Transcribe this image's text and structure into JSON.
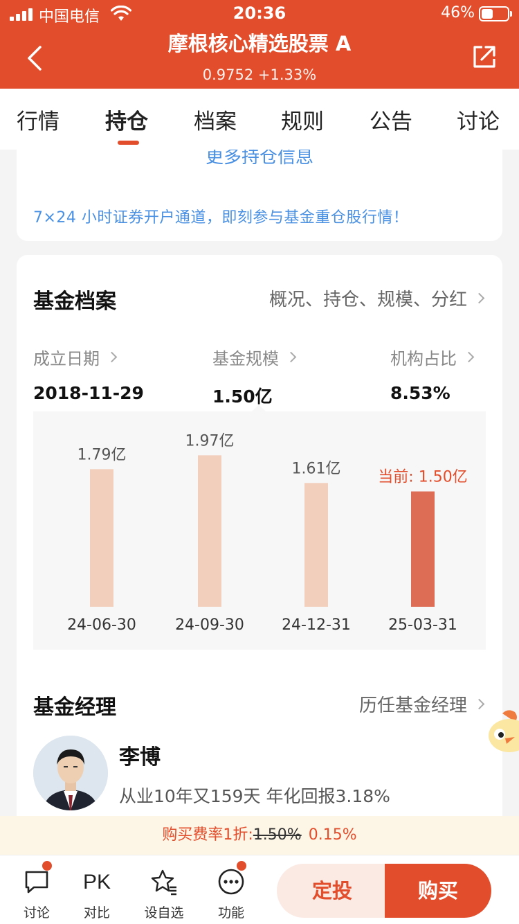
{
  "status_bar": {
    "carrier": "中国电信",
    "time": "20:36",
    "battery": "46%"
  },
  "header": {
    "title": "摩根核心精选股票 A",
    "subtitle": "0.9752 +1.33%"
  },
  "tabs": [
    {
      "label": "行情"
    },
    {
      "label": "持仓"
    },
    {
      "label": "档案"
    },
    {
      "label": "规则"
    },
    {
      "label": "公告"
    },
    {
      "label": "讨论"
    }
  ],
  "active_tab": "持仓",
  "holdings_card": {
    "more_link": "更多持仓信息",
    "promo": "7×24 小时证券开户通道，即刻参与基金重仓股行情！"
  },
  "fund_profile": {
    "title": "基金档案",
    "link": "概况、持仓、规模、分红",
    "stats": [
      {
        "label": "成立日期",
        "value": "2018-11-29"
      },
      {
        "label": "基金规模",
        "value": "1.50亿"
      },
      {
        "label": "机构占比",
        "value": "8.53%"
      }
    ]
  },
  "chart_data": {
    "type": "bar",
    "categories": [
      "24-06-30",
      "24-09-30",
      "24-12-31",
      "25-03-31"
    ],
    "values": [
      1.79,
      1.97,
      1.61,
      1.5
    ],
    "data_labels": [
      "1.79亿",
      "1.97亿",
      "1.61亿",
      "当前: 1.50亿"
    ],
    "unit": "亿",
    "highlight_index": 3,
    "colors": {
      "bar": "#f2cfbc",
      "highlight": "#dd6e55",
      "highlight_label": "#e24e2c"
    },
    "ylim": [
      0,
      2.2
    ]
  },
  "fund_manager": {
    "title": "基金经理",
    "link": "历任基金经理",
    "name": "李博",
    "desc": "从业10年又159天 年化回报3.18%"
  },
  "fee_bar": {
    "prefix": "购买费率1折:",
    "old": "1.50%",
    "new": "0.15%"
  },
  "bottom_bar": {
    "items": [
      {
        "label": "讨论",
        "icon": "chat-icon"
      },
      {
        "label": "对比",
        "icon": "pk-icon",
        "icon_text": "PK"
      },
      {
        "label": "设自选",
        "icon": "star-icon"
      },
      {
        "label": "功能",
        "icon": "more-icon"
      }
    ],
    "dingtou": "定投",
    "buy": "购买"
  },
  "colors": {
    "brand": "#e24e2c",
    "link": "#4a90e2"
  }
}
